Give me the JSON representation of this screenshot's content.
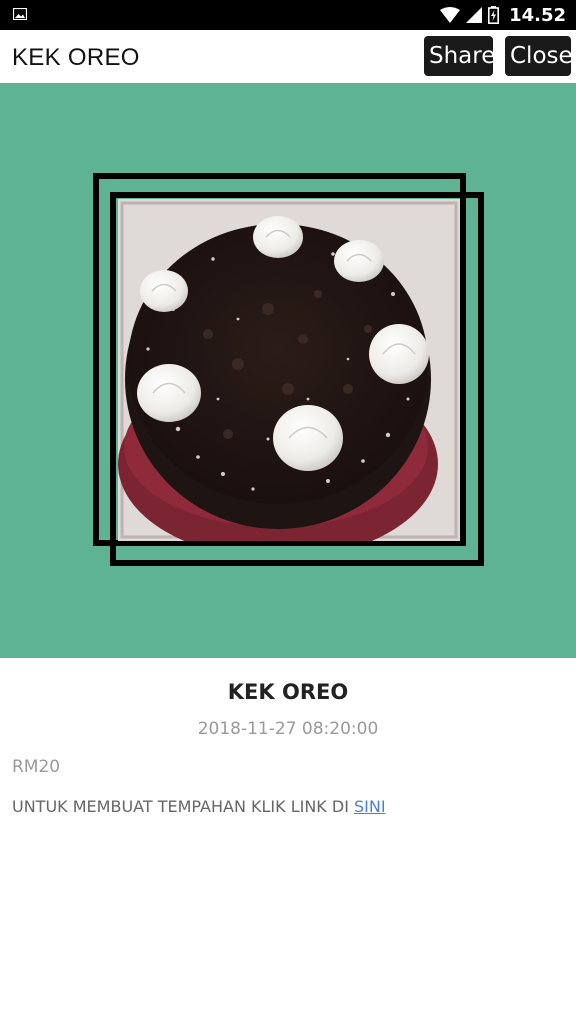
{
  "status_bar": {
    "time": "14.52",
    "left_icon": "image-icon",
    "icons": [
      "wifi-icon",
      "cell-signal-icon",
      "battery-charging-icon"
    ]
  },
  "header": {
    "title": "KEK OREO",
    "share_label": "Share",
    "close_label": "Close"
  },
  "hero": {
    "background_color": "#5fb395",
    "image": "oreo-cake-photo"
  },
  "post": {
    "title": "KEK OREO",
    "date": "2018-11-27 08:20:00",
    "price": "RM20",
    "description": "UNTUK MEMBUAT TEMPAHAN KLIK LINK DI ",
    "link_text": "SINI"
  }
}
